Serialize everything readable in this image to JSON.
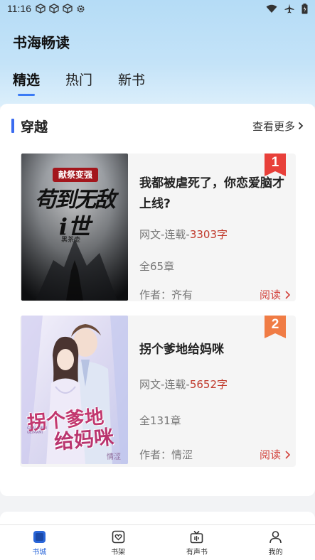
{
  "status_bar": {
    "time": "11:16",
    "left_icons": [
      "cube-icon",
      "cube-icon",
      "cube-icon",
      "gear-icon"
    ],
    "right_icons": [
      "wifi-icon",
      "airplane-icon",
      "battery-icon"
    ]
  },
  "app": {
    "title": "书海畅读"
  },
  "tabs": [
    {
      "label": "精选",
      "active": true
    },
    {
      "label": "热门",
      "active": false
    },
    {
      "label": "新书",
      "active": false
    }
  ],
  "section": {
    "title": "穿越",
    "more_label": "查看更多"
  },
  "books": [
    {
      "rank": "1",
      "rank_color": "#e8403a",
      "title": "我都被虐死了，你恋爱脑才上线?",
      "meta_prefix": "网文-连载-",
      "words": "3303字",
      "chapters": "全65章",
      "author": "作者：齐有",
      "read_label": "阅读",
      "cover": {
        "top_banner": "献祭变强",
        "main_line1": "苟到无敌",
        "main_line2": "ⅰ世",
        "author_mark": "黑茶壶",
        "palette": "dark-gray"
      }
    },
    {
      "rank": "2",
      "rank_color": "#f07c45",
      "title": "拐个爹地给妈咪",
      "meta_prefix": "网文-连载-",
      "words": "5652字",
      "chapters": "全131章",
      "author": "作者：情涩",
      "read_label": "阅读",
      "cover": {
        "main_line1": "拐个爹地",
        "main_line2": "给妈咪",
        "sub_text": "GUAI DIEDI GEIMAMI",
        "author_mark": "情涩",
        "palette": "pastel-purple"
      }
    }
  ],
  "bottom_nav": [
    {
      "label": "书城",
      "icon": "bookstore-icon",
      "active": true
    },
    {
      "label": "书架",
      "icon": "bookshelf-icon",
      "active": false
    },
    {
      "label": "有声书",
      "icon": "audiobook-icon",
      "active": false
    },
    {
      "label": "我的",
      "icon": "profile-icon",
      "active": false
    }
  ],
  "colors": {
    "accent": "#2a66d9",
    "section_bar": "#3b6cf0",
    "word_count": "#c0392b",
    "read_button": "#d2403a"
  }
}
